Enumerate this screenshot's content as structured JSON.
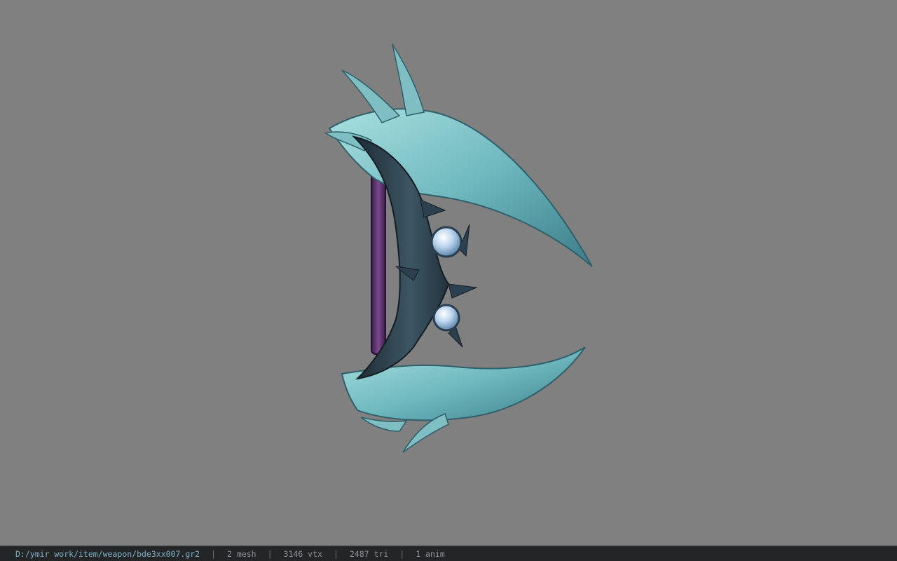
{
  "viewport": {
    "background": "#808080",
    "model_icon": "scythe-weapon-model"
  },
  "statusbar": {
    "path": "D:/ymir work/item/weapon/bde3xx007.gr2",
    "separator": "|",
    "mesh": "2 mesh",
    "vtx": "3146 vtx",
    "tri": "2487 tri",
    "anim": "1 anim"
  },
  "colors": {
    "blade": "#7fc4c8",
    "blade_dark": "#2f4a55",
    "handle": "#5a2f6b",
    "orb": "#c9dff0",
    "statusbar_bg": "#232526"
  }
}
